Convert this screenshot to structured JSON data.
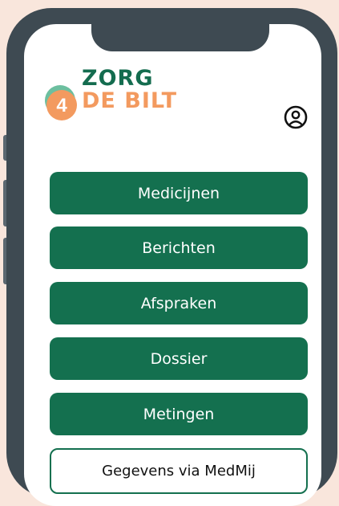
{
  "brand": {
    "line1": "ZORG",
    "line2": "DE BILT",
    "badge": "4",
    "primary_color": "#146c4f",
    "accent_color": "#f39a5f"
  },
  "header": {
    "profile_icon": "user-circle-icon"
  },
  "menu": [
    {
      "label": "Medicijnen"
    },
    {
      "label": "Berichten"
    },
    {
      "label": "Afspraken"
    },
    {
      "label": "Dossier"
    },
    {
      "label": "Metingen"
    }
  ],
  "secondary": {
    "label": "Gegevens via MedMij"
  }
}
